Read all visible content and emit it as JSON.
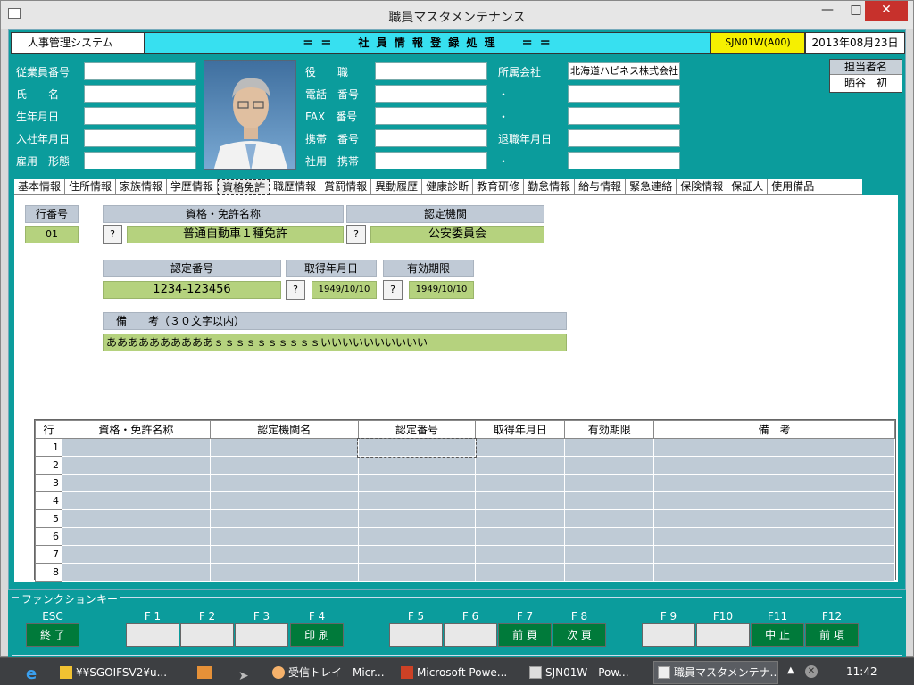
{
  "window": {
    "title": "職員マスタメンテナンス"
  },
  "header": {
    "system": "人事管理システム",
    "banner": "＝ ＝　　社 員 情 報 登 録 処 理　　＝ ＝",
    "program_code": "SJN01W(A00)",
    "date": "2013年08月23日"
  },
  "fields": {
    "employee_no": {
      "label": "従業員番号",
      "value": ""
    },
    "name": {
      "label": "氏　　名",
      "value": ""
    },
    "birthdate": {
      "label": "生年月日",
      "value": ""
    },
    "hire_date": {
      "label": "入社年月日",
      "value": ""
    },
    "employment_type": {
      "label": "雇用　形態",
      "value": ""
    },
    "position": {
      "label": "役　　職",
      "value": ""
    },
    "phone": {
      "label": "電話　番号",
      "value": ""
    },
    "fax": {
      "label": "FAX　番号",
      "value": ""
    },
    "mobile": {
      "label": "携帯　番号",
      "value": ""
    },
    "company_mobile": {
      "label": "社用　携帯",
      "value": ""
    },
    "company": {
      "label": "所属会社",
      "value": "北海道ハピネス株式会社"
    },
    "dot1": {
      "label": "・",
      "value": ""
    },
    "dot2": {
      "label": "・",
      "value": ""
    },
    "retire_date": {
      "label": "退職年月日",
      "value": ""
    },
    "dot3": {
      "label": "・",
      "value": ""
    }
  },
  "tanto": {
    "label": "担当者名",
    "value": "晒谷　初"
  },
  "tabs": [
    "基本情報",
    "住所情報",
    "家族情報",
    "学歴情報",
    "資格免許",
    "職歴情報",
    "賞罰情報",
    "異動履歴",
    "健康診断",
    "教育研修",
    "勤怠情報",
    "給与情報",
    "緊急連絡",
    "保険情報",
    "保証人",
    "使用備品"
  ],
  "active_tab": "資格免許",
  "form": {
    "row_no_label": "行番号",
    "row_no": "01",
    "license_name_label": "資格・免許名称",
    "license_name": "普通自動車１種免許",
    "agency_label": "認定機関",
    "agency": "公安委員会",
    "cert_no_label": "認定番号",
    "cert_no": "1234-123456",
    "acquired_label": "取得年月日",
    "acquired": "1949/10/10",
    "expiry_label": "有効期限",
    "expiry": "1949/10/10",
    "remarks_label": "備　　考（３０文字以内）",
    "remarks": "ああああああああああｓｓｓｓｓｓｓｓｓｓいいいいいいいいいい",
    "q": "?"
  },
  "grid": {
    "headers": [
      "行",
      "資格・免許名称",
      "認定機関名",
      "認定番号",
      "取得年月日",
      "有効期限",
      "備　考"
    ],
    "rows": [
      "1",
      "2",
      "3",
      "4",
      "5",
      "6",
      "7",
      "8"
    ]
  },
  "fkeys": {
    "title": "ファンクションキー",
    "keys": [
      {
        "k": "ESC",
        "label": "終 了"
      },
      {
        "k": "F 1",
        "label": ""
      },
      {
        "k": "F 2",
        "label": ""
      },
      {
        "k": "F 3",
        "label": ""
      },
      {
        "k": "F 4",
        "label": "印 刷"
      },
      {
        "k": "F 5",
        "label": ""
      },
      {
        "k": "F 6",
        "label": ""
      },
      {
        "k": "F 7",
        "label": "前 頁"
      },
      {
        "k": "F 8",
        "label": "次 頁"
      },
      {
        "k": "F 9",
        "label": ""
      },
      {
        "k": "F10",
        "label": ""
      },
      {
        "k": "F11",
        "label": "中 止"
      },
      {
        "k": "F12",
        "label": "前 項"
      }
    ]
  },
  "taskbar": {
    "items": [
      "¥¥SGOIFSV2¥u...",
      "受信トレイ - Micr...",
      "Microsoft Powe...",
      "SJN01W - Pow...",
      "職員マスタメンテナ..."
    ],
    "clock": "11:42"
  }
}
